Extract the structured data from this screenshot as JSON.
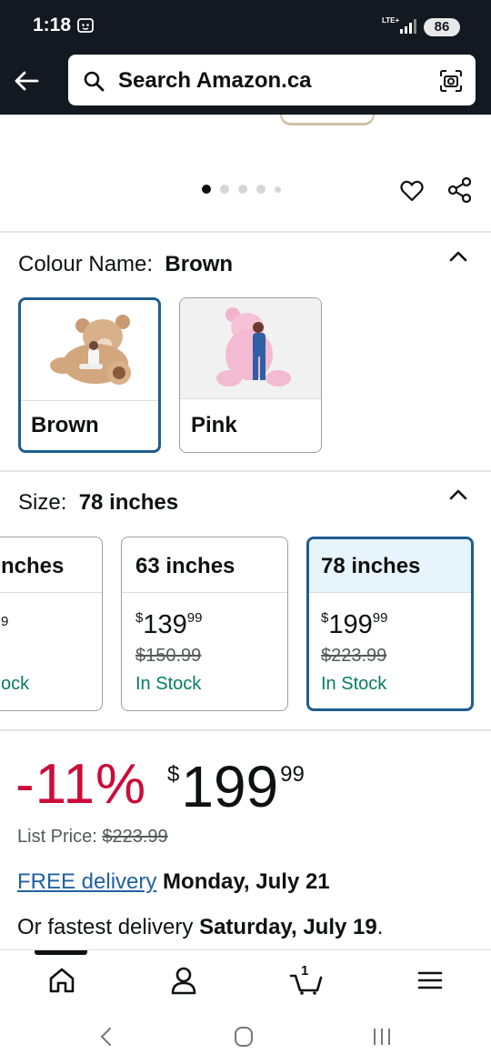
{
  "status_bar": {
    "time": "1:18",
    "network_label": "LTE+",
    "battery": "86"
  },
  "search": {
    "text": "Search Amazon.ca"
  },
  "gallery": {
    "dot_count": 5,
    "active_dot": 0
  },
  "colour": {
    "label": "Colour Name:",
    "selected": "Brown",
    "options": [
      {
        "name": "Brown",
        "selected": true
      },
      {
        "name": "Pink",
        "selected": false
      }
    ]
  },
  "size": {
    "label": "Size:",
    "selected": "78 inches",
    "options": [
      {
        "name": "nches",
        "price_whole": "",
        "price_cents": "9",
        "list_price": "",
        "stock": "ock",
        "selected": false
      },
      {
        "name": "63 inches",
        "currency": "$",
        "price_whole": "139",
        "price_cents": "99",
        "list_price": "$150.99",
        "stock": "In Stock",
        "selected": false
      },
      {
        "name": "78 inches",
        "currency": "$",
        "price_whole": "199",
        "price_cents": "99",
        "list_price": "$223.99",
        "stock": "In Stock",
        "selected": true
      }
    ]
  },
  "price": {
    "discount": "-11%",
    "currency": "$",
    "whole": "199",
    "cents": "99",
    "list_label": "List Price:",
    "list_price": "$223.99"
  },
  "delivery": {
    "free_link": "FREE delivery",
    "date": "Monday, July 21",
    "fastest_prefix": "Or fastest delivery",
    "fastest_date": "Saturday, July 19",
    "fastest_suffix": "."
  },
  "bottom_nav": {
    "cart_count": "1",
    "items": [
      "home-icon",
      "account-icon",
      "cart-icon",
      "menu-icon"
    ]
  },
  "colors": {
    "header_bg": "#131921",
    "selected_border": "#1f5d8f",
    "discount": "#cc0c39",
    "stock": "#067d62",
    "link": "#2162a1"
  }
}
